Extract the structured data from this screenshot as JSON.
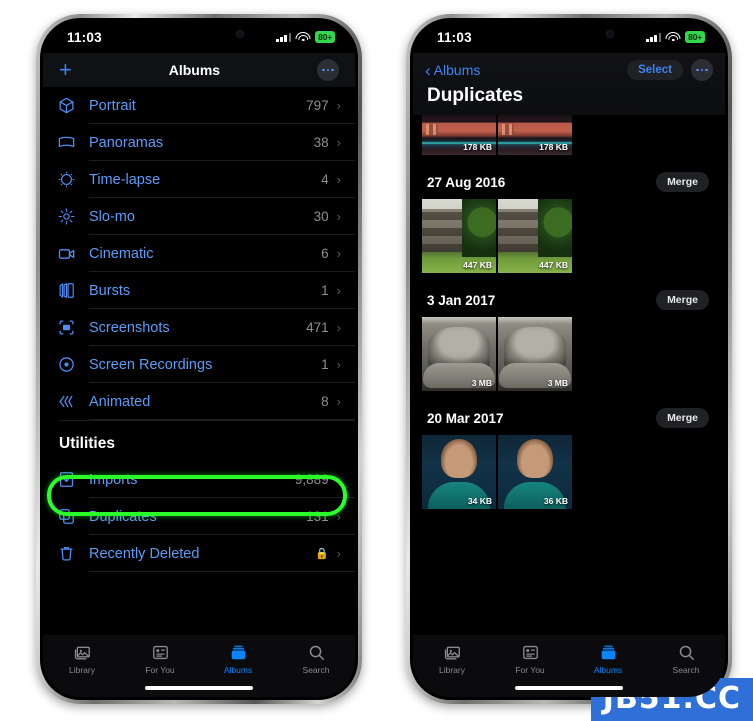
{
  "left_phone": {
    "status_bar": {
      "time": "11:03",
      "cellular_icon": "signal-bars-icon",
      "wifi_icon": "wifi-icon",
      "battery_label": "80+"
    },
    "nav": {
      "add_icon": "plus-icon",
      "title": "Albums",
      "more_icon": "ellipsis-icon"
    },
    "albums": [
      {
        "icon": "portrait-cube-icon",
        "label": "Portrait",
        "count": "797",
        "chevron": "›"
      },
      {
        "icon": "panorama-icon",
        "label": "Panoramas",
        "count": "38",
        "chevron": "›"
      },
      {
        "icon": "time-lapse-icon",
        "label": "Time-lapse",
        "count": "4",
        "chevron": "›"
      },
      {
        "icon": "slo-mo-icon",
        "label": "Slo-mo",
        "count": "30",
        "chevron": "›"
      },
      {
        "icon": "cinematic-icon",
        "label": "Cinematic",
        "count": "6",
        "chevron": "›"
      },
      {
        "icon": "bursts-icon",
        "label": "Bursts",
        "count": "1",
        "chevron": "›"
      },
      {
        "icon": "screenshots-icon",
        "label": "Screenshots",
        "count": "471",
        "chevron": "›"
      },
      {
        "icon": "screen-recordings-icon",
        "label": "Screen Recordings",
        "count": "1",
        "chevron": "›"
      },
      {
        "icon": "animated-icon",
        "label": "Animated",
        "count": "8",
        "chevron": "›"
      }
    ],
    "utilities": {
      "heading": "Utilities",
      "items": [
        {
          "icon": "imports-icon",
          "label": "Imports",
          "count": "9,889",
          "chevron": "›",
          "locked": false
        },
        {
          "icon": "duplicates-icon",
          "label": "Duplicates",
          "count": "131",
          "chevron": "›",
          "locked": false,
          "highlighted": true
        },
        {
          "icon": "trash-icon",
          "label": "Recently Deleted",
          "count": "",
          "chevron": "›",
          "locked": true
        }
      ]
    },
    "tabs": [
      {
        "icon": "library-icon",
        "label": "Library",
        "active": false
      },
      {
        "icon": "for-you-icon",
        "label": "For You",
        "active": false
      },
      {
        "icon": "albums-icon",
        "label": "Albums",
        "active": true
      },
      {
        "icon": "search-icon",
        "label": "Search",
        "active": false
      }
    ]
  },
  "right_phone": {
    "status_bar": {
      "time": "11:03",
      "cellular_icon": "signal-bars-icon",
      "wifi_icon": "wifi-icon",
      "battery_label": "80+"
    },
    "nav": {
      "back_icon": "chevron-left-icon",
      "back_label": "Albums",
      "select_label": "Select",
      "more_icon": "ellipsis-icon"
    },
    "large_title": "Duplicates",
    "groups": [
      {
        "date": "",
        "merge_label": "",
        "partial": true,
        "photos": [
          {
            "art": "art-street",
            "size": "178 KB"
          },
          {
            "art": "art-street",
            "size": "178 KB"
          }
        ]
      },
      {
        "date": "27 Aug 2016",
        "merge_label": "Merge",
        "partial": false,
        "photos": [
          {
            "art": "art-building",
            "size": "447 KB"
          },
          {
            "art": "art-building",
            "size": "447 KB"
          }
        ]
      },
      {
        "date": "3 Jan 2017",
        "merge_label": "Merge",
        "partial": false,
        "photos": [
          {
            "art": "art-chair",
            "size": "3 MB"
          },
          {
            "art": "art-chair",
            "size": "3 MB"
          }
        ]
      },
      {
        "date": "20 Mar 2017",
        "merge_label": "Merge",
        "partial": false,
        "photos": [
          {
            "art": "art-person",
            "size": "34 KB"
          },
          {
            "art": "art-person",
            "size": "36 KB"
          }
        ]
      }
    ],
    "tabs": [
      {
        "icon": "library-icon",
        "label": "Library",
        "active": false
      },
      {
        "icon": "for-you-icon",
        "label": "For You",
        "active": false
      },
      {
        "icon": "albums-icon",
        "label": "Albums",
        "active": true
      },
      {
        "icon": "search-icon",
        "label": "Search",
        "active": false
      }
    ]
  },
  "watermark": {
    "text": "JB51.CC",
    "color": "#2f6fd8"
  },
  "accent_colors": {
    "ios_blue": "#3b82f6",
    "highlight_green": "#2aff2a",
    "battery_green": "#32d74b"
  }
}
